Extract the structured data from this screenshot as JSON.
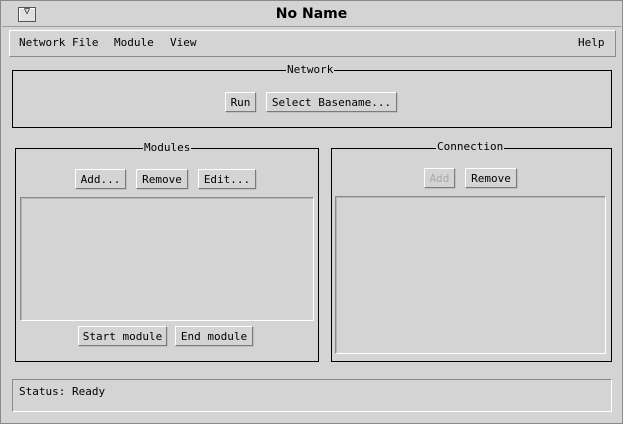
{
  "window": {
    "title": "No Name",
    "menu_glyph": "▽"
  },
  "menubar": {
    "items": [
      "Network File",
      "Module",
      "View"
    ],
    "help": "Help"
  },
  "network": {
    "title": "Network",
    "run_label": "Run",
    "select_basename_label": "Select Basename..."
  },
  "modules": {
    "title": "Modules",
    "add_label": "Add...",
    "remove_label": "Remove",
    "edit_label": "Edit...",
    "start_label": "Start module",
    "end_label": "End module"
  },
  "connection": {
    "title": "Connection",
    "add_label": "Add",
    "remove_label": "Remove"
  },
  "status": {
    "text": "Status: Ready"
  }
}
